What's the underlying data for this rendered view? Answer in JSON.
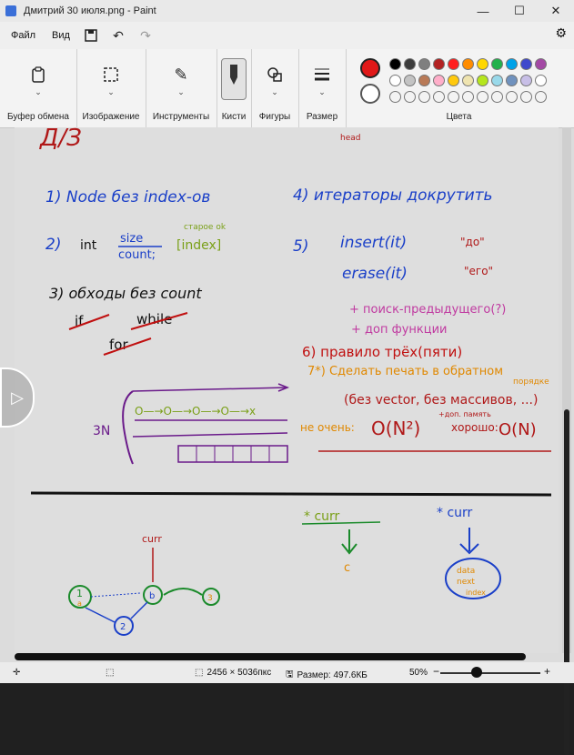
{
  "window": {
    "title": "Дмитрий 30 июля.png - Paint",
    "controls": {
      "minimize": "—",
      "maximize": "☐",
      "close": "✕"
    }
  },
  "menubar": {
    "file": "Файл",
    "view": "Вид",
    "save_icon": "save-icon",
    "undo_icon": "undo-icon",
    "redo_icon": "redo-icon",
    "settings_icon": "settings-icon"
  },
  "ribbon": {
    "groups": [
      {
        "label": "Буфер обмена",
        "icon": "clipboard-icon"
      },
      {
        "label": "Изображение",
        "icon": "image-select-icon"
      },
      {
        "label": "Инструменты",
        "icon": "tools-icon"
      },
      {
        "label": "Кисти",
        "icon": "brush-icon"
      },
      {
        "label": "Фигуры",
        "icon": "shapes-icon"
      },
      {
        "label": "Размер",
        "icon": "size-icon"
      }
    ],
    "colors_label": "Цвета",
    "primary_color": "#e01818",
    "secondary_color": "#ffffff",
    "palette_row1": [
      "#000000",
      "#3c3c3c",
      "#7f7f7f",
      "#b22222",
      "#ff1e1e",
      "#ff8c00",
      "#ffd700",
      "#22b14c",
      "#00a2e8",
      "#3f48cc",
      "#a349a4"
    ],
    "palette_row2": [
      "#ffffff",
      "#c3c3c3",
      "#b97a57",
      "#ffaec9",
      "#ffc90e",
      "#efe4b0",
      "#b5e61d",
      "#99d9ea",
      "#7092be",
      "#c8bfe7",
      "#ffffff"
    ]
  },
  "canvas_notes": {
    "top_title": "Д/З",
    "head_label": "head",
    "item1": "1) Node без index-ов",
    "item2_num": "2)",
    "item2_int": "int",
    "item2_size": "size",
    "item2_count": "count;",
    "item2_index": "[index]",
    "item2_note": "старое ok",
    "item3": "3) обходы без count",
    "item3_if": "if",
    "item3_while": "while",
    "item3_for": "for",
    "item4": "4) итераторы докрутить",
    "item5_num": "5)",
    "item5_insert": "insert(it)",
    "item5_insert_note": "\"до\"",
    "item5_erase": "erase(it)",
    "item5_erase_note": "\"его\"",
    "item5_plus1": "+ поиск-предыдущего(?)",
    "item5_plus2": "+ доп функции",
    "item6": "6) правило трёх(пяти)",
    "item7_a": "7*) Сделать печать в обратном",
    "item7_b": "порядке",
    "item7_c": "(без vector, без массивов, ...)",
    "bad_label": "не очень:",
    "bad_complexity": "O(N²)",
    "extra_mem": "+доп. память",
    "good_label": "хорошо:",
    "good_complexity": "O(N)",
    "three_n": "3N",
    "curr1": "* curr",
    "curr1_c": "c",
    "curr2": "* curr",
    "curr2_data": "data",
    "curr2_next": "next",
    "curr2_index": "index",
    "node_curr": "curr",
    "node1": "1",
    "node1_sub": "a",
    "node2": "2",
    "node3": "3",
    "nodeb": "b"
  },
  "statusbar": {
    "dimensions": "2456 × 5036пкс",
    "size": "Размер: 497.6КБ",
    "zoom": "50%"
  }
}
